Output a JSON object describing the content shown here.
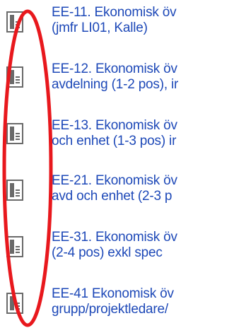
{
  "report_list": {
    "items": [
      {
        "line1": "EE-11. Ekonomisk öv",
        "line2": "(jmfr LI01, Kalle)",
        "icon": "report-document-icon"
      },
      {
        "line1": "EE-12. Ekonomisk öv",
        "line2": "avdelning (1-2 pos), ir",
        "icon": "report-document-icon"
      },
      {
        "line1": "EE-13. Ekonomisk öv",
        "line2": "och enhet (1-3 pos) ir",
        "icon": "report-document-icon"
      },
      {
        "line1": "EE-21. Ekonomisk öv",
        "line2": "avd och enhet (2-3 p",
        "icon": "report-document-icon"
      },
      {
        "line1": "EE-31. Ekonomisk öv",
        "line2": "(2-4 pos) exkl spec",
        "icon": "report-document-icon"
      },
      {
        "line1": "EE-41 Ekonomisk öv",
        "line2": "grupp/projektledare/",
        "icon": "report-document-icon"
      }
    ]
  },
  "colors": {
    "link_text": "#1e49b8",
    "icon_fill": "#6a6a6a",
    "annotation": "#e8181d"
  }
}
